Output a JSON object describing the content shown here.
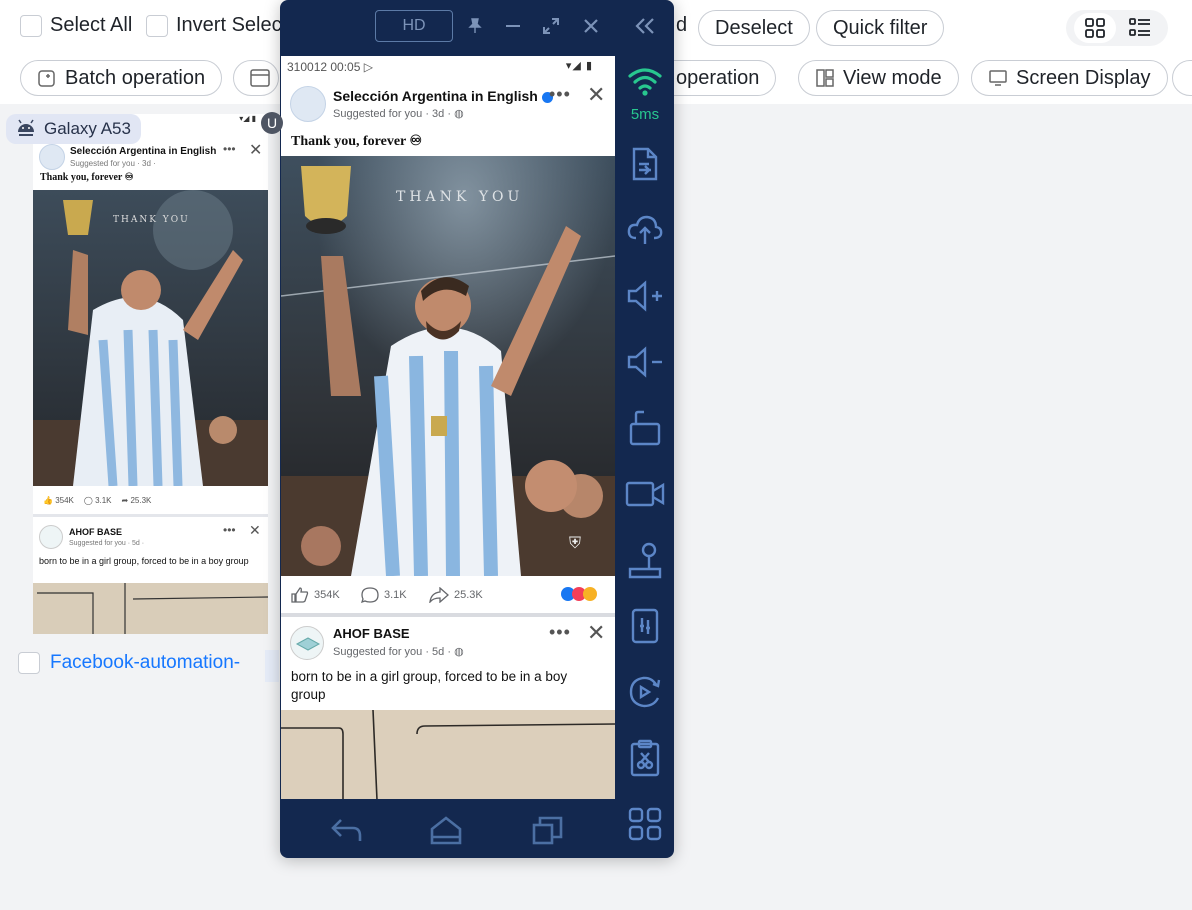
{
  "toolbar": {
    "row1": {
      "select_all": "Select All",
      "invert_selection": "Invert Selec",
      "hidden_suffix": "d",
      "deselect": "Deselect",
      "quick_filter": "Quick filter"
    },
    "row2": {
      "batch_operation": "Batch operation",
      "operation": "operation",
      "view_mode": "View mode",
      "screen_display": "Screen Display"
    }
  },
  "device_card": {
    "device_model": "Galaxy A53",
    "badge": "U",
    "device_name": "Facebook-automation-",
    "mini": {
      "post1": {
        "page_name": "Selección Argentina in English",
        "meta": "Suggested for you · 3d ·",
        "caption": "Thank you, forever ♾",
        "likes": "354K",
        "comments": "3.1K",
        "shares": "25.3K"
      },
      "post2": {
        "page_name": "AHOF BASE",
        "meta": "Suggested for you · 5d ·",
        "text": "born to be in a girl group, forced to be in a boy group"
      }
    }
  },
  "phone_window": {
    "quality": "HD",
    "latency": "5ms",
    "colors": {
      "frame": "#13284f",
      "signal": "#28c78f",
      "icon": "#5c86c7"
    },
    "status_bar": {
      "time": "310012 00:05"
    },
    "post1": {
      "page_name": "Selección Argentina in English",
      "meta": "Suggested for you · 3d ·",
      "caption": "Thank you, forever ♾",
      "photo_text": "THANK YOU",
      "likes": "354K",
      "comments": "3.1K",
      "shares": "25.3K"
    },
    "post2": {
      "page_name": "AHOF BASE",
      "meta": "Suggested for you · 5d ·",
      "text": "born to be in a girl group, forced to be in a boy group"
    },
    "side_tools": [
      "wifi-signal-icon",
      "file-transfer-icon",
      "cloud-upload-icon",
      "volume-up-icon",
      "volume-down-icon",
      "rotate-screen-icon",
      "screen-record-icon",
      "joystick-icon",
      "phone-settings-icon",
      "screen-rotation-icon",
      "clipboard-icon",
      "more-apps-icon"
    ],
    "nav": [
      "back-icon",
      "home-icon",
      "recents-icon"
    ]
  }
}
